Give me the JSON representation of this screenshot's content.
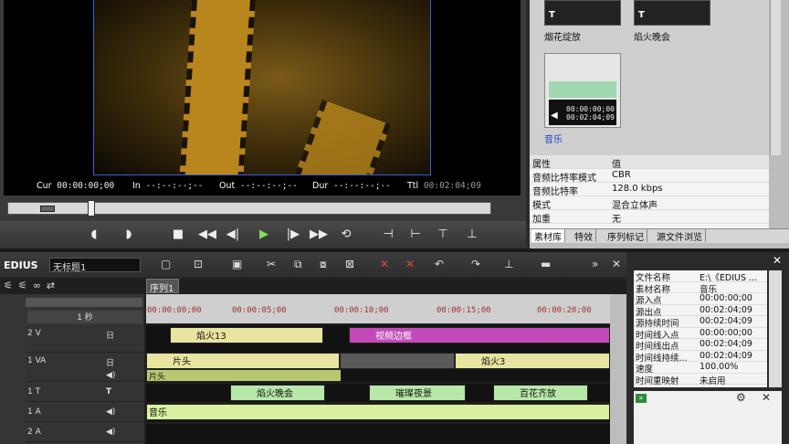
{
  "player": {
    "timecodes": [
      {
        "label": "Cur",
        "value": "00:00:00;00"
      },
      {
        "label": "In",
        "value": "--:--:--;--"
      },
      {
        "label": "Out",
        "value": "--:--:--;--"
      },
      {
        "label": "Dur",
        "value": "--:--:--;--"
      },
      {
        "label": "Ttl",
        "value": "00:02:04;09"
      }
    ]
  },
  "bin": {
    "clips": [
      {
        "name": "烟花绽放",
        "icon": "T"
      },
      {
        "name": "焰火晚会",
        "icon": "T"
      },
      {
        "name": "音乐",
        "tc1": "00:00:00;00",
        "tc2": "00:02:04;09"
      }
    ],
    "properties_header": {
      "k": "属性",
      "v": "值"
    },
    "properties": [
      {
        "k": "音频比特率模式",
        "v": "CBR"
      },
      {
        "k": "音频比特率",
        "v": "128.0 kbps"
      },
      {
        "k": "模式",
        "v": "混合立体声"
      },
      {
        "k": "加重",
        "v": "无"
      }
    ],
    "tabs": [
      "素材库",
      "特效",
      "序列标记",
      "源文件浏览"
    ]
  },
  "timeline": {
    "app": "EDIUS",
    "project": "无标题1",
    "sequence_tab": "序列1",
    "scale": "1 秒",
    "ruler": [
      "00:00:00;00",
      "00:00:05;00",
      "00:00:10;00",
      "00:00:15;00",
      "00:00:20;00"
    ],
    "tracks": [
      {
        "name": "2 V"
      },
      {
        "name": "1 VA"
      },
      {
        "name": "1 T"
      },
      {
        "name": "1 A"
      },
      {
        "name": "2 A"
      }
    ],
    "clips": {
      "v2a": "焰火13",
      "v2b": "视频边框",
      "va1a": "片头",
      "va1b": "焰火3",
      "va1c": "片头",
      "t1a": "焰火晚会",
      "t1b": "璀璨夜景",
      "t1c": "百花齐放",
      "a1": "音乐"
    }
  },
  "info": {
    "rows": [
      {
        "k": "文件名称",
        "v": "E:\\《EDIUS ..."
      },
      {
        "k": "素材名称",
        "v": "音乐"
      },
      {
        "k": "源入点",
        "v": "00:00:00;00"
      },
      {
        "k": "源出点",
        "v": "00:02:04;09"
      },
      {
        "k": "源持续时间",
        "v": "00:02:04;09"
      },
      {
        "k": "时间线入点",
        "v": "00:00:00;00"
      },
      {
        "k": "时间线出点",
        "v": "00:02:04;09"
      },
      {
        "k": "时间线持续...",
        "v": "00:02:04;09"
      },
      {
        "k": "速度",
        "v": "100.00%"
      },
      {
        "k": "时间重映射",
        "v": "未启用"
      }
    ]
  }
}
